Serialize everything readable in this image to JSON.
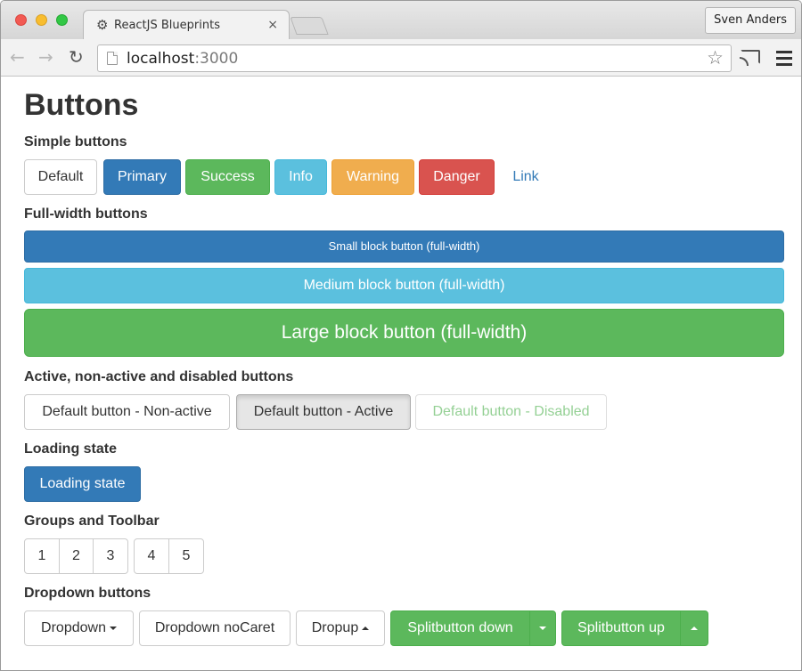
{
  "browser": {
    "tab_title": "ReactJS Blueprints",
    "profile_name": "Sven Anders",
    "url_host": "localhost",
    "url_port": ":3000",
    "icons": [
      "gear-icon",
      "close-icon",
      "back-arrow-icon",
      "forward-arrow-icon",
      "reload-icon",
      "page-icon",
      "star-icon",
      "cast-icon",
      "menu-icon"
    ]
  },
  "page": {
    "title": "Buttons",
    "sections": {
      "simple": "Simple buttons",
      "full_width": "Full-width buttons",
      "states": "Active, non-active and disabled buttons",
      "loading": "Loading state",
      "groups": "Groups and Toolbar",
      "dropdowns": "Dropdown buttons"
    },
    "simple_buttons": {
      "default": "Default",
      "primary": "Primary",
      "success": "Success",
      "info": "Info",
      "warning": "Warning",
      "danger": "Danger",
      "link": "Link"
    },
    "block_buttons": {
      "small": "Small block button (full-width)",
      "medium": "Medium block button (full-width)",
      "large": "Large block button (full-width)"
    },
    "state_buttons": {
      "non_active": "Default button - Non-active",
      "active": "Default button - Active",
      "disabled": "Default button - Disabled"
    },
    "loading_button": "Loading state",
    "group1": [
      "1",
      "2",
      "3"
    ],
    "group2": [
      "4",
      "5"
    ],
    "dropdown_buttons": {
      "dropdown": "Dropdown",
      "nocaret": "Dropdown noCaret",
      "dropup": "Dropup",
      "split_down": "Splitbutton down",
      "split_up": "Splitbutton up"
    }
  },
  "colors": {
    "primary": "#337ab7",
    "success": "#5cb85c",
    "info": "#5bc0de",
    "warning": "#f0ad4e",
    "danger": "#d9534f"
  }
}
